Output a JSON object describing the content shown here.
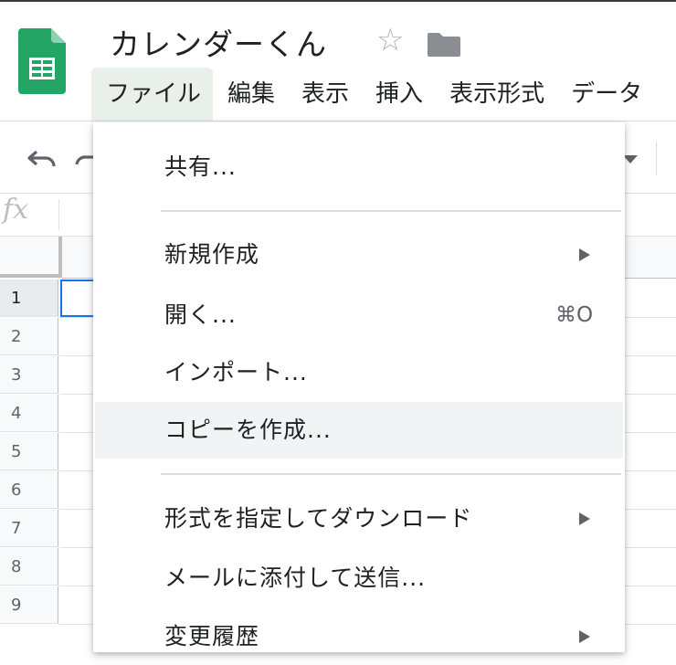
{
  "doc": {
    "title": "カレンダーくん"
  },
  "menubar": {
    "items": [
      {
        "label": "ファイル"
      },
      {
        "label": "編集"
      },
      {
        "label": "表示"
      },
      {
        "label": "挿入"
      },
      {
        "label": "表示形式"
      },
      {
        "label": "データ"
      }
    ]
  },
  "formula_bar": {
    "fx_label": "fx"
  },
  "grid": {
    "rows": [
      "1",
      "2",
      "3",
      "4",
      "5",
      "6",
      "7",
      "8",
      "9"
    ]
  },
  "file_menu": {
    "share": "共有...",
    "new": "新規作成",
    "open": "開く...",
    "open_shortcut": "⌘O",
    "import": "インポート...",
    "make_copy": "コピーを作成...",
    "download": "形式を指定してダウンロード",
    "email": "メールに添付して送信...",
    "history": "変更履歴"
  },
  "colors": {
    "sheets_green": "#23a566",
    "accent_blue": "#1a73e8",
    "menu_active_bg": "#e8f0e9",
    "hover_bg": "#f1f3f4"
  },
  "icons": [
    "sheets-logo-icon",
    "star-icon",
    "folder-icon",
    "undo-icon",
    "redo-icon",
    "dropdown-arrow-icon",
    "fx-icon",
    "submenu-arrow-icon"
  ]
}
